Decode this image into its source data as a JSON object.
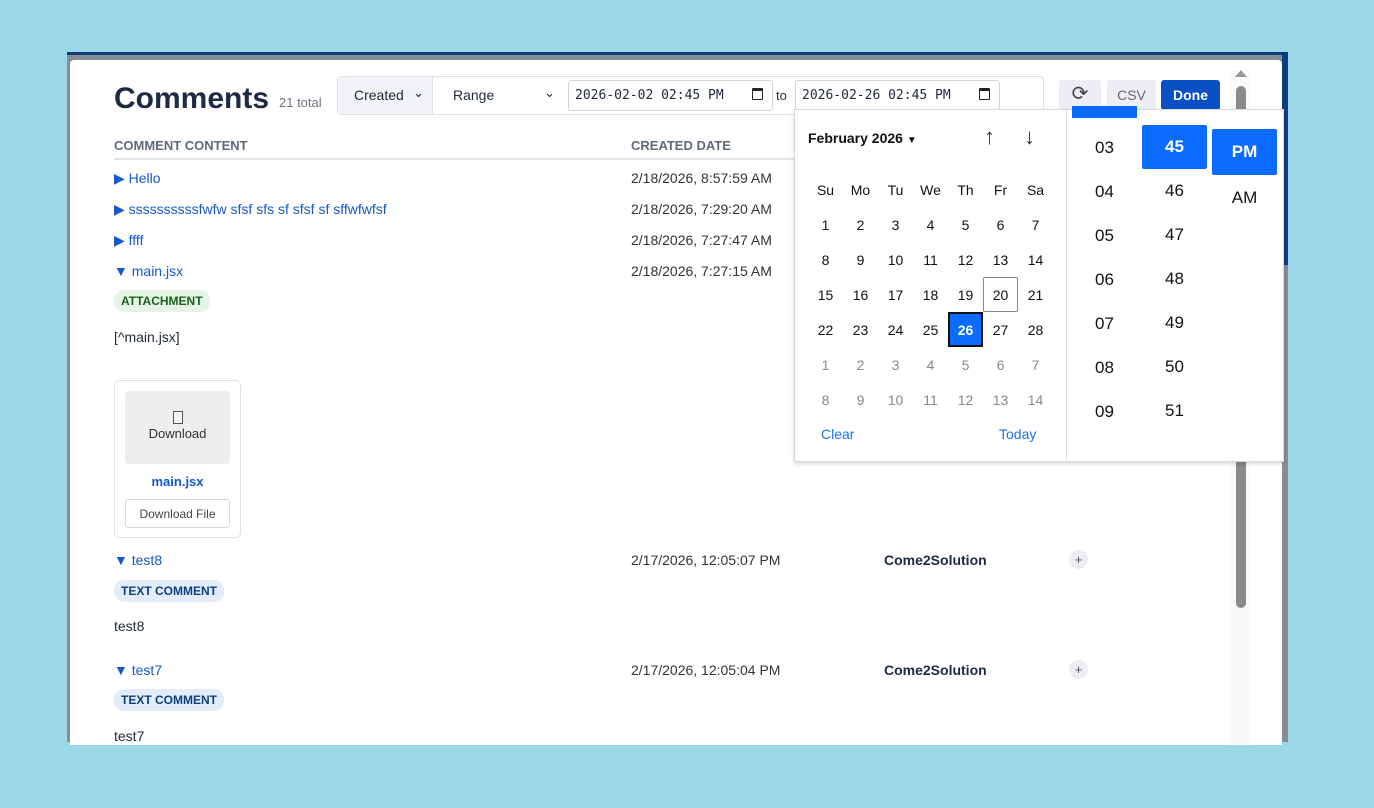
{
  "header": {
    "title": "Comments",
    "total": "21 total"
  },
  "filter": {
    "field": "Created",
    "mode": "Range",
    "from": "2026-02-02 02:45 PM",
    "to_label": "to",
    "to": "2026-02-26 02:45 PM"
  },
  "toolbar": {
    "refresh_icon": "refresh-icon",
    "csv": "CSV",
    "done": "Done"
  },
  "columns": {
    "content": "COMMENT CONTENT",
    "created": "CREATED DATE"
  },
  "rows": [
    {
      "content": "Hello",
      "date": "2/18/2026, 8:57:59 AM",
      "expanded": false
    },
    {
      "content": "ssssssssssfwfw sfsf sfs sf sfsf sf sffwfwfsf",
      "date": "2/18/2026, 7:29:20 AM",
      "expanded": false
    },
    {
      "content": "ffff",
      "date": "2/18/2026, 7:27:47 AM",
      "expanded": false
    },
    {
      "content": "main.jsx",
      "date": "2/18/2026, 7:27:15 AM",
      "expanded": true,
      "badge": "ATTACHMENT",
      "body": "[^main.jsx]",
      "attachment": {
        "preview": "Download",
        "name": "main.jsx",
        "button": "Download File"
      }
    },
    {
      "content": "test8",
      "date": "2/17/2026, 12:05:07 PM",
      "author": "Come2Solution",
      "expanded": true,
      "badge": "TEXT COMMENT",
      "body": "test8"
    },
    {
      "content": "test7",
      "date": "2/17/2026, 12:05:04 PM",
      "author": "Come2Solution",
      "expanded": true,
      "badge": "TEXT COMMENT",
      "body": "test7"
    }
  ],
  "picker": {
    "month": "February 2026",
    "dow": [
      "Su",
      "Mo",
      "Tu",
      "We",
      "Th",
      "Fr",
      "Sa"
    ],
    "days": [
      "1",
      "2",
      "3",
      "4",
      "5",
      "6",
      "7",
      "8",
      "9",
      "10",
      "11",
      "12",
      "13",
      "14",
      "15",
      "16",
      "17",
      "18",
      "19",
      "20",
      "21",
      "22",
      "23",
      "24",
      "25",
      "26",
      "27",
      "28",
      "1",
      "2",
      "3",
      "4",
      "5",
      "6",
      "7",
      "8",
      "9",
      "10",
      "11",
      "12",
      "13",
      "14"
    ],
    "today": "20",
    "selected": "26",
    "clear": "Clear",
    "today_label": "Today",
    "hours": [
      "03",
      "04",
      "05",
      "06",
      "07",
      "08",
      "09"
    ],
    "minutes": [
      "45",
      "46",
      "47",
      "48",
      "49",
      "50",
      "51"
    ],
    "selected_minute": "45",
    "ampm": [
      "PM",
      "AM"
    ],
    "selected_ampm": "PM"
  },
  "colors": {
    "accent": "#0a6cff",
    "done": "#0b4fc4",
    "link": "#1558c9"
  }
}
